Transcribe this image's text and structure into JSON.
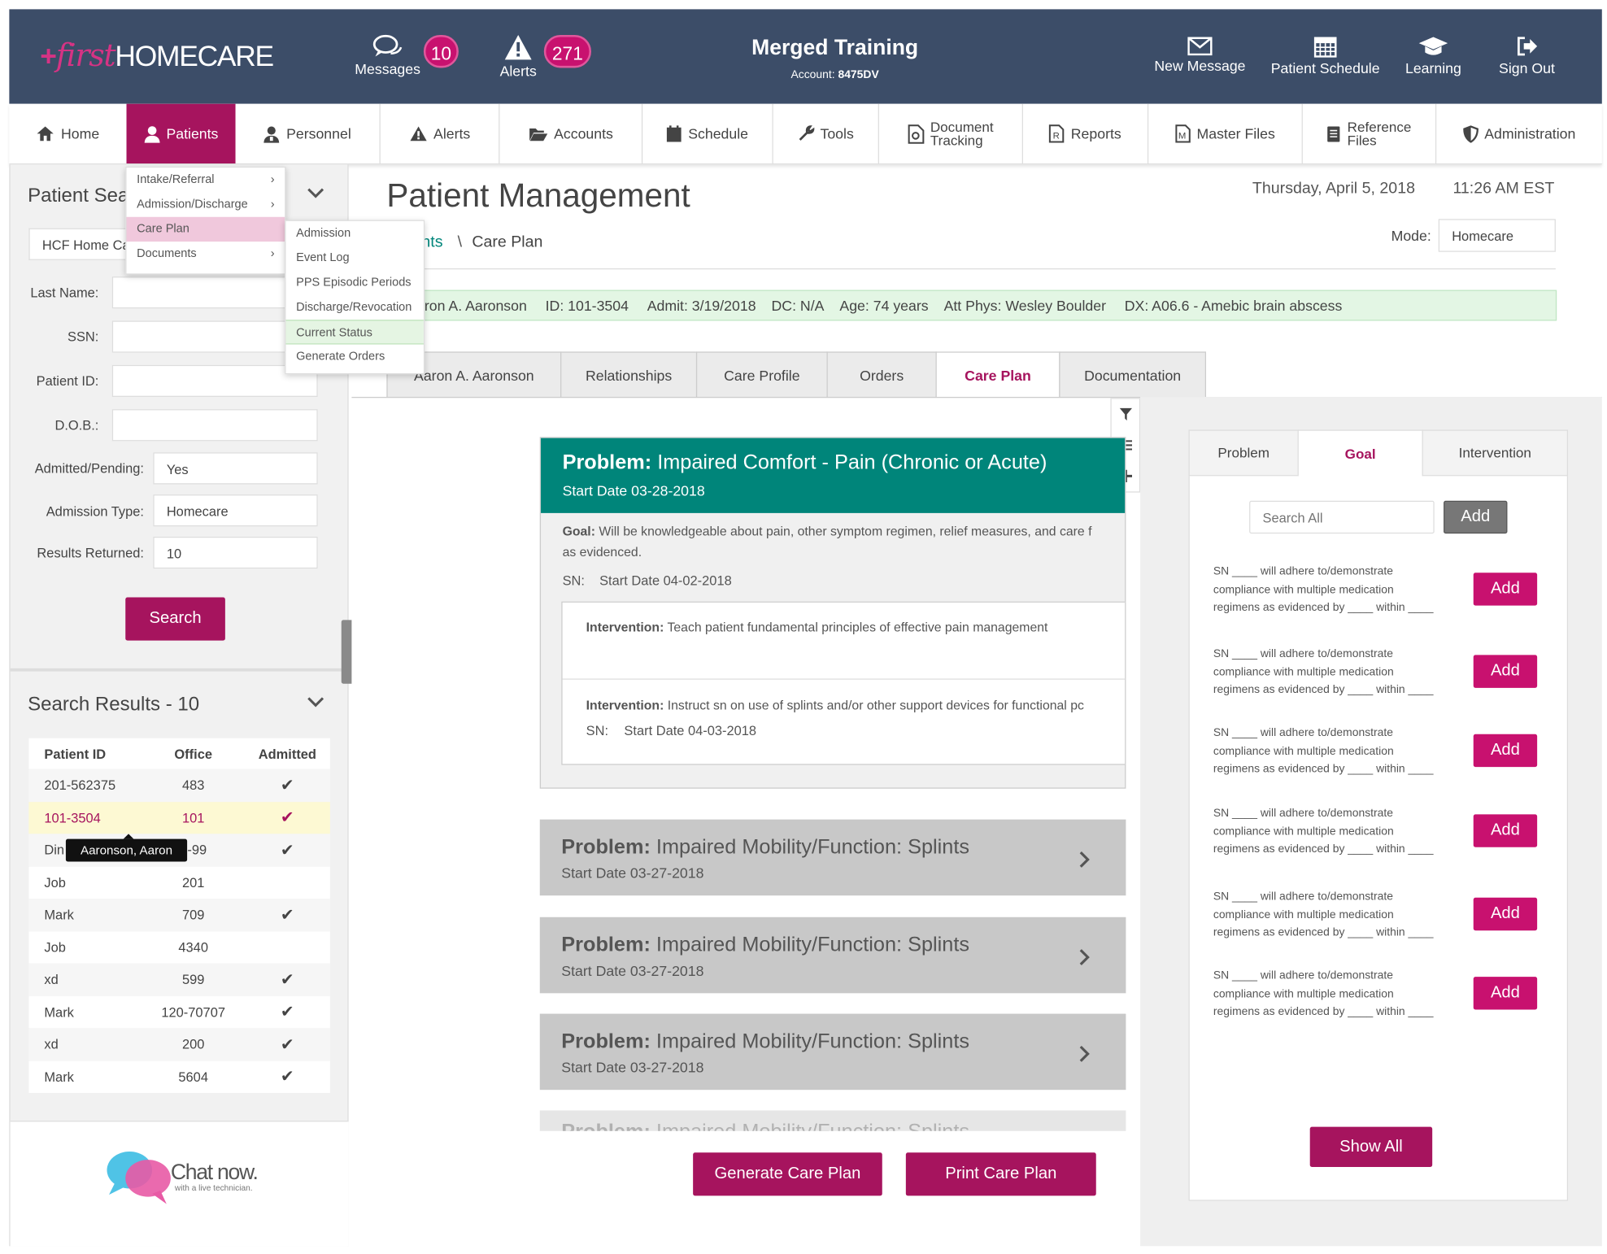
{
  "brand": {
    "plus": "+",
    "first": "first",
    "homecare": "HOMECARE"
  },
  "topbar": {
    "messages": {
      "label": "Messages",
      "count": "10"
    },
    "alerts": {
      "label": "Alerts",
      "count": "271"
    },
    "account_title": "Merged Training",
    "account_prefix": "Account: ",
    "account_id": "8475DV",
    "new_message": "New Message",
    "patient_schedule": "Patient Schedule",
    "learning": "Learning",
    "sign_out": "Sign Out"
  },
  "nav": {
    "home": "Home",
    "patients": "Patients",
    "personnel": "Personnel",
    "alerts": "Alerts",
    "accounts": "Accounts",
    "schedule": "Schedule",
    "tools": "Tools",
    "document_tracking_1": "Document",
    "document_tracking_2": "Tracking",
    "reports": "Reports",
    "master_files": "Master Files",
    "reference_files_1": "Reference",
    "reference_files_2": "Files",
    "administration": "Administration"
  },
  "patients_menu": [
    "Intake/Referral",
    "Admission/Discharge",
    "Care Plan",
    "Documents"
  ],
  "careplan_menu": [
    "Admission",
    "Event Log",
    "PPS Episodic Periods",
    "Discharge/Revocation",
    "Current Status",
    "Generate Orders"
  ],
  "search": {
    "title": "Patient Sea",
    "office_value": "HCF Home Ca",
    "last_name": "Last Name:",
    "ssn": "SSN:",
    "patient_id": "Patient ID:",
    "dob": "D.O.B.:",
    "admitted_pending": "Admitted/Pending:",
    "admitted_value": "Yes",
    "admission_type": "Admission Type:",
    "admission_type_value": "Homecare",
    "results_returned": "Results Returned:",
    "results_value": "10",
    "button": "Search"
  },
  "results": {
    "title": "Search Results - 10",
    "headers": [
      "Patient ID",
      "Office",
      "Admitted"
    ],
    "tooltip": "Aaronson, Aaron",
    "rows": [
      {
        "id": "201-562375",
        "office": "483",
        "admitted": "✔"
      },
      {
        "id": "101-3504",
        "office": "101",
        "admitted": "✔"
      },
      {
        "id": "Din",
        "office": "4-99",
        "admitted": "✔"
      },
      {
        "id": "Job",
        "office": "201",
        "admitted": ""
      },
      {
        "id": "Mark",
        "office": "709",
        "admitted": "✔"
      },
      {
        "id": "Job",
        "office": "4340",
        "admitted": ""
      },
      {
        "id": "xd",
        "office": "599",
        "admitted": "✔"
      },
      {
        "id": "Mark",
        "office": "120-70707",
        "admitted": "✔"
      },
      {
        "id": "xd",
        "office": "200",
        "admitted": "✔"
      },
      {
        "id": "Mark",
        "office": "5604",
        "admitted": "✔"
      }
    ]
  },
  "chat": {
    "main": "Chat now.",
    "sub": "with a live technician."
  },
  "page": {
    "title": "Patient Management",
    "date": "Thursday, April 5, 2018",
    "time": "11:26 AM EST",
    "breadcrumb_parent": "nts",
    "breadcrumb_sep": "\\",
    "breadcrumb_current": "Care Plan",
    "mode_label": "Mode:",
    "mode_value": "Homecare"
  },
  "patient_bar": {
    "name": "aron A. Aaronson",
    "id": "ID: 101-3504",
    "admit": "Admit: 3/19/2018",
    "dc": "DC: N/A",
    "age": "Age: 74 years",
    "phys": "Att Phys:  Wesley Boulder",
    "dx": "DX: A06.6 - Amebic brain abscess"
  },
  "tabs": [
    "Aaron A. Aaronson",
    "Relationships",
    "Care Profile",
    "Orders",
    "Care Plan",
    "Documentation"
  ],
  "problem_active": {
    "label": "Problem:",
    "title": " Impaired Comfort - Pain (Chronic or Acute)",
    "date": "Start Date 03-28-2018",
    "goal_label": "Goal:",
    "goal_text": " Will be knowledgeable about pain, other symptom regimen, relief measures, and care f",
    "goal_text2": "as evidenced.",
    "sn_label": "SN:",
    "sn_date": "Start Date 04-02-2018",
    "interventions": [
      {
        "label": "Intervention:",
        "text": " Teach patient fundamental principles of effective pain management"
      },
      {
        "label": "Intervention:",
        "text": " Instruct sn on use of splints and/or other support devices for functional pc",
        "sn_label": "SN:",
        "sn_date": "Start Date 04-03-2018"
      }
    ]
  },
  "problems_collapsed": [
    {
      "label": "Problem:",
      "title": " Impaired Mobility/Function: Splints",
      "date": "Start Date 03-27-2018"
    },
    {
      "label": "Problem:",
      "title": " Impaired Mobility/Function: Splints",
      "date": "Start Date 03-27-2018"
    },
    {
      "label": "Problem:",
      "title": " Impaired Mobility/Function: Splints",
      "date": "Start Date 03-27-2018"
    },
    {
      "label": "Problem:",
      "title": " Impaired Mobility/Function: Splints"
    }
  ],
  "actions": {
    "generate": "Generate Care Plan",
    "print": "Print Care Plan"
  },
  "right": {
    "tabs": [
      "Problem",
      "Goal",
      "Intervention"
    ],
    "search_placeholder": "Search All",
    "add": "Add",
    "goal_line1": "SN ____ will adhere to/demonstrate",
    "goal_line2": "compliance with multiple medication",
    "goal_line3": "regimens as evidenced by ____ within ____",
    "show_all": "Show All"
  },
  "colors": {
    "header": "#3c4d68",
    "accent": "#a6145e",
    "pill": "#c8116f",
    "teal": "#00857a",
    "patient_bar": "#e3f6e4"
  }
}
